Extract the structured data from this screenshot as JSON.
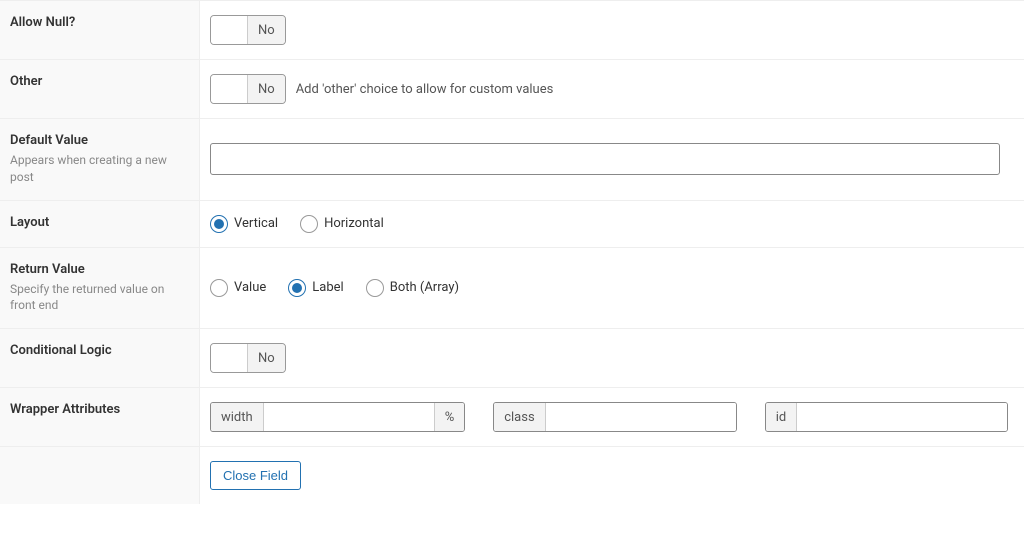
{
  "rows": {
    "allow_null": {
      "label": "Allow Null?",
      "toggle_text": "No"
    },
    "other": {
      "label": "Other",
      "toggle_text": "No",
      "desc": "Add 'other' choice to allow for custom values"
    },
    "default_value": {
      "label": "Default Value",
      "desc": "Appears when creating a new post",
      "value": ""
    },
    "layout": {
      "label": "Layout",
      "options": {
        "vertical": "Vertical",
        "horizontal": "Horizontal"
      }
    },
    "return_value": {
      "label": "Return Value",
      "desc": "Specify the returned value on front end",
      "options": {
        "value": "Value",
        "label": "Label",
        "both": "Both (Array)"
      }
    },
    "conditional_logic": {
      "label": "Conditional Logic",
      "toggle_text": "No"
    },
    "wrapper": {
      "label": "Wrapper Attributes",
      "width_pre": "width",
      "width_suf": "%",
      "class_pre": "class",
      "id_pre": "id",
      "width_val": "",
      "class_val": "",
      "id_val": ""
    }
  },
  "footer": {
    "close_field": "Close Field"
  }
}
